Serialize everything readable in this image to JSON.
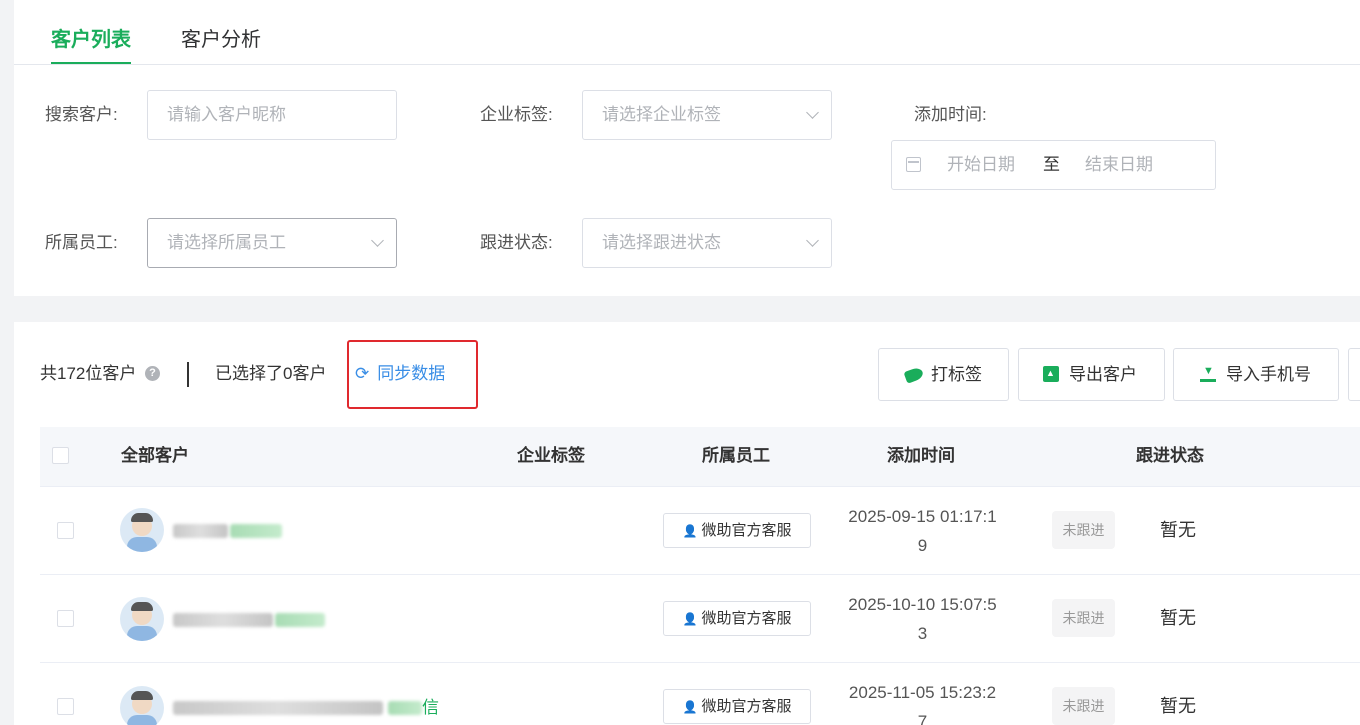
{
  "tabs": [
    {
      "label": "客户列表",
      "active": true
    },
    {
      "label": "客户分析",
      "active": false
    }
  ],
  "filters": {
    "search": {
      "label": "搜索客户:",
      "placeholder": "请输入客户昵称"
    },
    "tag": {
      "label": "企业标签:",
      "placeholder": "请选择企业标签"
    },
    "time": {
      "label": "添加时间:",
      "start_placeholder": "开始日期",
      "separator": "至",
      "end_placeholder": "结束日期"
    },
    "staff": {
      "label": "所属员工:",
      "placeholder": "请选择所属员工"
    },
    "status": {
      "label": "跟进状态:",
      "placeholder": "请选择跟进状态"
    }
  },
  "toolbar": {
    "count_text": "共172位客户",
    "help_icon": "?",
    "selected_text": "已选择了0客户",
    "sync_label": "同步数据",
    "sync_icon": "⟳",
    "tag_button": "打标签",
    "export_button": "导出客户",
    "import_button": "导入手机号"
  },
  "table": {
    "columns": [
      "全部客户",
      "企业标签",
      "所属员工",
      "添加时间",
      "跟进状态"
    ],
    "rows": [
      {
        "name_visible": "",
        "staff": "微助官方客服",
        "time_line1": "2025-09-15 01:17:1",
        "time_line2": "9",
        "status": "未跟进",
        "note": "暂无"
      },
      {
        "name_visible": "",
        "staff": "微助官方客服",
        "time_line1": "2025-10-10 15:07:5",
        "time_line2": "3",
        "status": "未跟进",
        "note": "暂无"
      },
      {
        "name_visible": "信",
        "staff": "微助官方客服",
        "time_line1": "2025-11-05 15:23:2",
        "time_line2": "7",
        "status": "未跟进",
        "note": "暂无"
      }
    ]
  },
  "colors": {
    "accent": "#1aad5b",
    "link": "#3a8ee6",
    "highlight": "#e0292e"
  }
}
